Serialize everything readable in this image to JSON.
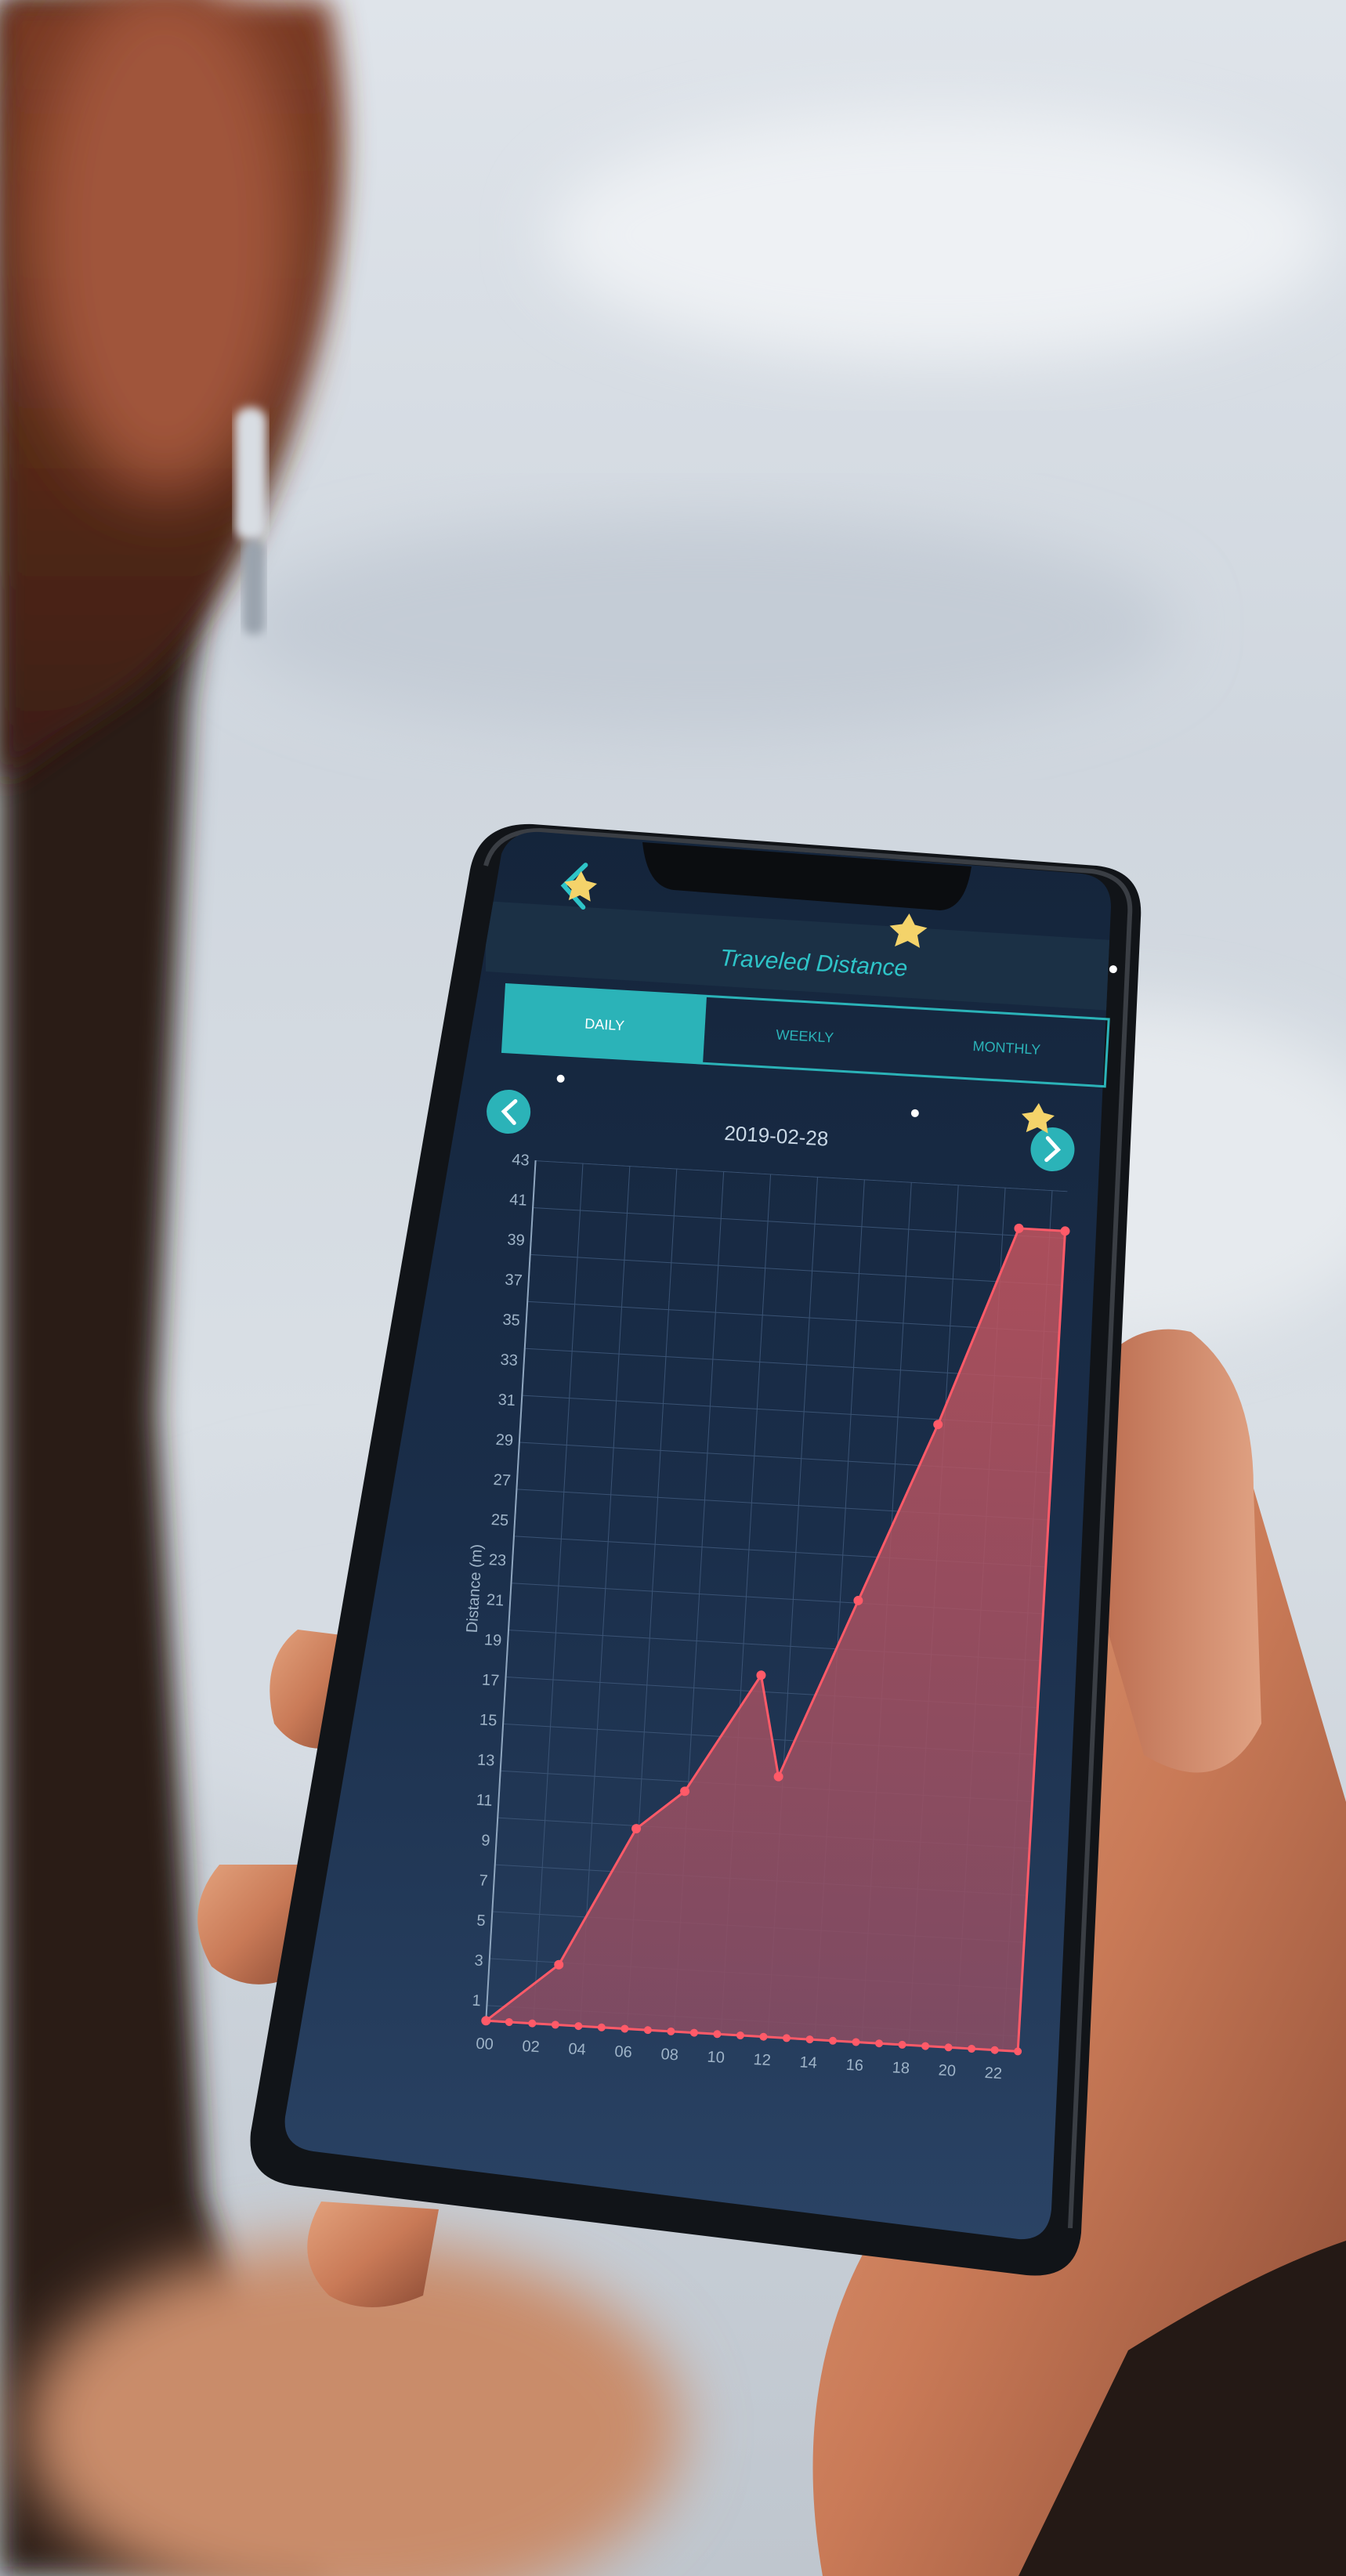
{
  "app": {
    "title": "Traveled Distance",
    "date": "2019-02-28",
    "tabs": [
      {
        "label": "DAILY",
        "active": true
      },
      {
        "label": "WEEKLY",
        "active": false
      },
      {
        "label": "MONTHLY",
        "active": false
      }
    ],
    "back_icon": "chevron-left-icon",
    "prev_icon": "chevron-left-icon",
    "next_icon": "chevron-right-icon",
    "accent_color": "#2bb3b8",
    "chart_fill_color": "#c4555f",
    "chart_line_color": "#ff5a68"
  },
  "chart_data": {
    "type": "area",
    "ylabel": "Distance (m)",
    "y_ticks": [
      "1",
      "3",
      "5",
      "7",
      "9",
      "11",
      "13",
      "15",
      "17",
      "19",
      "21",
      "23",
      "25",
      "27",
      "29",
      "31",
      "33",
      "35",
      "37",
      "39",
      "41",
      "43"
    ],
    "x_ticks": [
      "00",
      "02",
      "04",
      "06",
      "08",
      "10",
      "12",
      "14",
      "16",
      "18",
      "20",
      "22"
    ],
    "ylim": [
      1,
      43
    ],
    "grid": true,
    "x": [
      0,
      3,
      6,
      8,
      11,
      12,
      15,
      18,
      21,
      23
    ],
    "values": [
      0,
      3,
      10,
      12,
      18,
      13,
      22,
      31,
      41,
      41
    ]
  }
}
